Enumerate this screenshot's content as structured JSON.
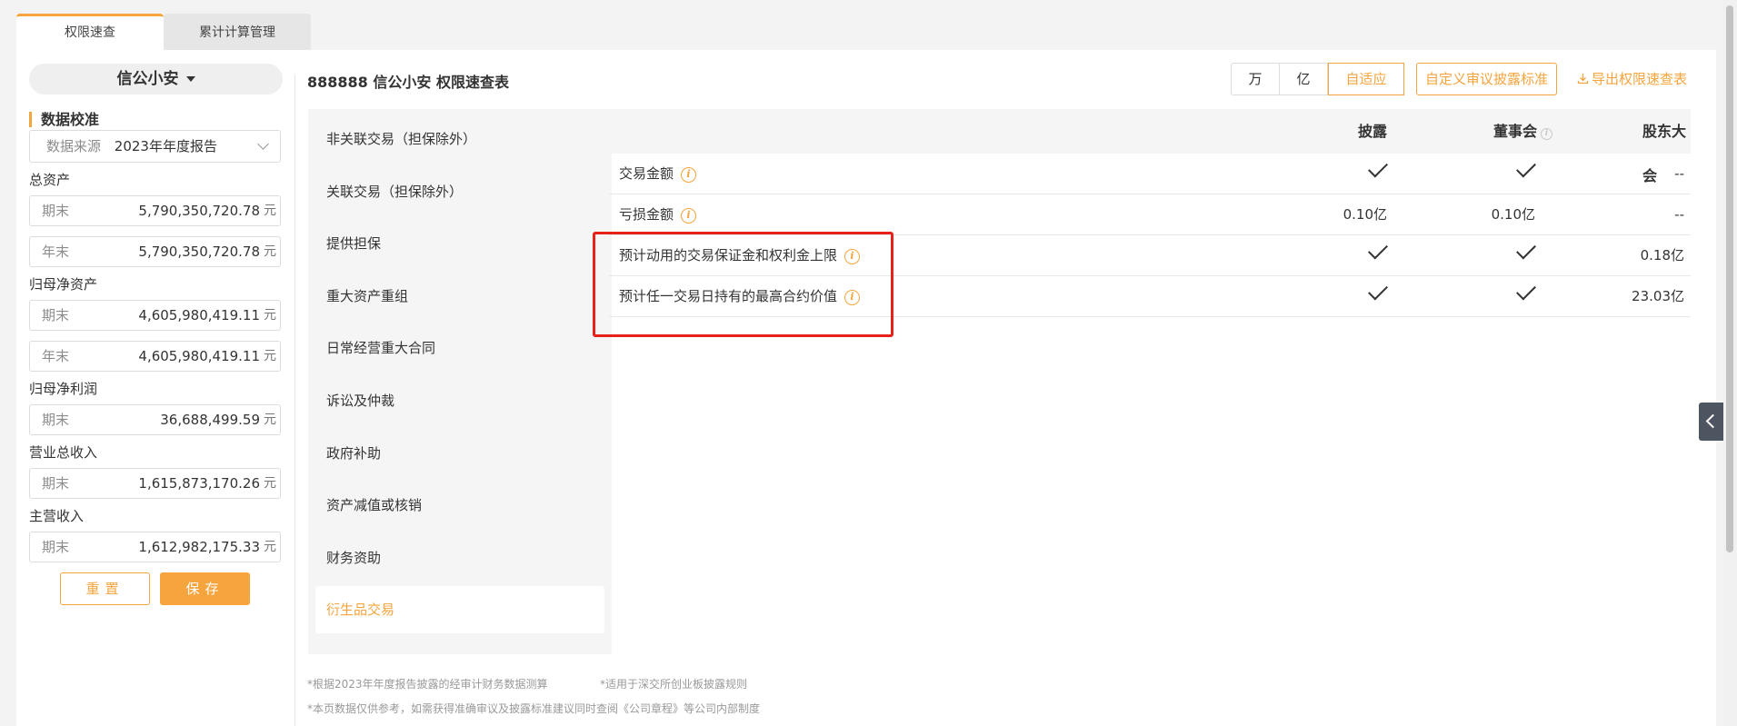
{
  "tabs": [
    {
      "label": "权限速查",
      "active": true
    },
    {
      "label": "累计计算管理",
      "active": false
    }
  ],
  "company": {
    "name": "信公小安"
  },
  "calibration": {
    "title": "数据校准",
    "source_label": "数据来源",
    "source_value": "2023年年度报告"
  },
  "metrics": [
    {
      "label": "总资产",
      "fields": [
        {
          "name": "期末",
          "value": "5,790,350,720.78",
          "unit": "元"
        },
        {
          "name": "年末",
          "value": "5,790,350,720.78",
          "unit": "元"
        }
      ]
    },
    {
      "label": "归母净资产",
      "fields": [
        {
          "name": "期末",
          "value": "4,605,980,419.11",
          "unit": "元"
        },
        {
          "name": "年末",
          "value": "4,605,980,419.11",
          "unit": "元"
        }
      ]
    },
    {
      "label": "归母净利润",
      "fields": [
        {
          "name": "期末",
          "value": "36,688,499.59",
          "unit": "元"
        }
      ]
    },
    {
      "label": "营业总收入",
      "fields": [
        {
          "name": "期末",
          "value": "1,615,873,170.26",
          "unit": "元"
        }
      ]
    },
    {
      "label": "主营收入",
      "fields": [
        {
          "name": "期末",
          "value": "1,612,982,175.33",
          "unit": "元"
        }
      ]
    }
  ],
  "buttons": {
    "reset": "重置",
    "save": "保存"
  },
  "header": {
    "title": "888888 信公小安 权限速查表",
    "units": [
      "万",
      "亿",
      "自适应"
    ],
    "active_unit": "自适应",
    "custom_label": "自定义审议披露标准",
    "export_label": "导出权限速查表"
  },
  "categories": [
    "非关联交易（担保除外）",
    "关联交易（担保除外）",
    "提供担保",
    "重大资产重组",
    "日常经营重大合同",
    "诉讼及仲裁",
    "政府补助",
    "资产减值或核销",
    "财务资助",
    "衍生品交易"
  ],
  "active_category": "衍生品交易",
  "table": {
    "columns": [
      "披露",
      "董事会",
      "股东大会"
    ],
    "rows": [
      {
        "name": "交易金额",
        "disclose": "check",
        "board": "check",
        "shareholders": "--"
      },
      {
        "name": "亏损金额",
        "disclose": "0.10亿",
        "board": "0.10亿",
        "shareholders": "--"
      },
      {
        "name": "预计动用的交易保证金和权利金上限",
        "disclose": "check",
        "board": "check",
        "shareholders": "0.18亿"
      },
      {
        "name": "预计任一交易日持有的最高合约价值",
        "disclose": "check",
        "board": "check",
        "shareholders": "23.03亿"
      }
    ]
  },
  "footnotes": {
    "line1a": "*根据2023年年度报告披露的经审计财务数据测算",
    "line1b": "*适用于深交所创业板披露规则",
    "line2": "*本页数据仅供参考，如需获得准确审议及披露标准建议同时查阅《公司章程》等公司内部制度"
  },
  "colors": {
    "accent": "#f6a43d",
    "highlight": "#e8201a"
  }
}
